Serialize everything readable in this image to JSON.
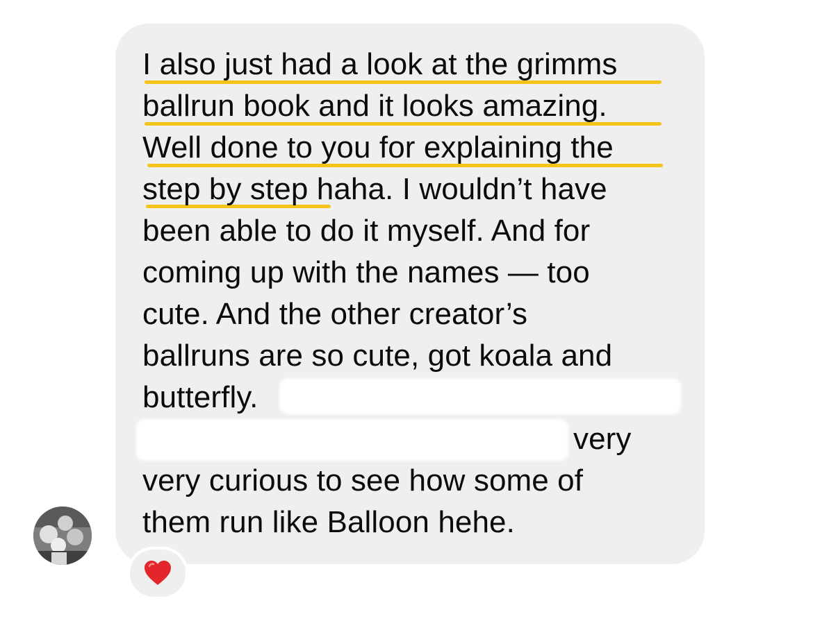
{
  "message": {
    "lines": [
      "I also just had a look at the grimms",
      "ballrun book and it looks amazing.",
      "Well done to you for explaining the",
      "step by step haha. I wouldn’t have",
      "been able to do it myself. And for",
      "coming up with the names — too",
      "cute. And the other creator’s",
      "ballruns are so cute, got koala and",
      "butterfly.",
      "very",
      "very curious to see how some of",
      "them run like Balloon hehe."
    ]
  },
  "reaction": {
    "emoji": "heart-emoji",
    "color": "#e3262b"
  },
  "avatar": {
    "icon": "profile-photo"
  },
  "colors": {
    "bubble": "#efefef",
    "highlight_underline": "#f2c318",
    "text": "#0b0b0b"
  }
}
